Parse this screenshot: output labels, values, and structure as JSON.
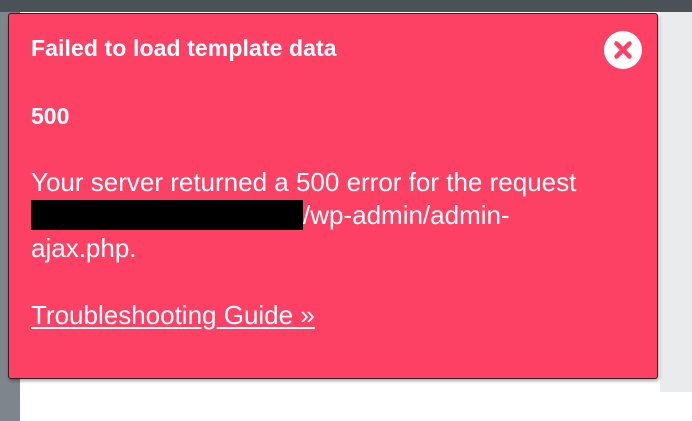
{
  "notice": {
    "title": "Failed to load template data",
    "code": "500",
    "message_start": "Your server returned a 500 error for the request",
    "message_end": "/wp-admin/admin-ajax.php.",
    "link_label": "Troubleshooting Guide »",
    "close_icon": "close-icon",
    "background_color": "#fd4165",
    "text_color": "#ffffff"
  }
}
